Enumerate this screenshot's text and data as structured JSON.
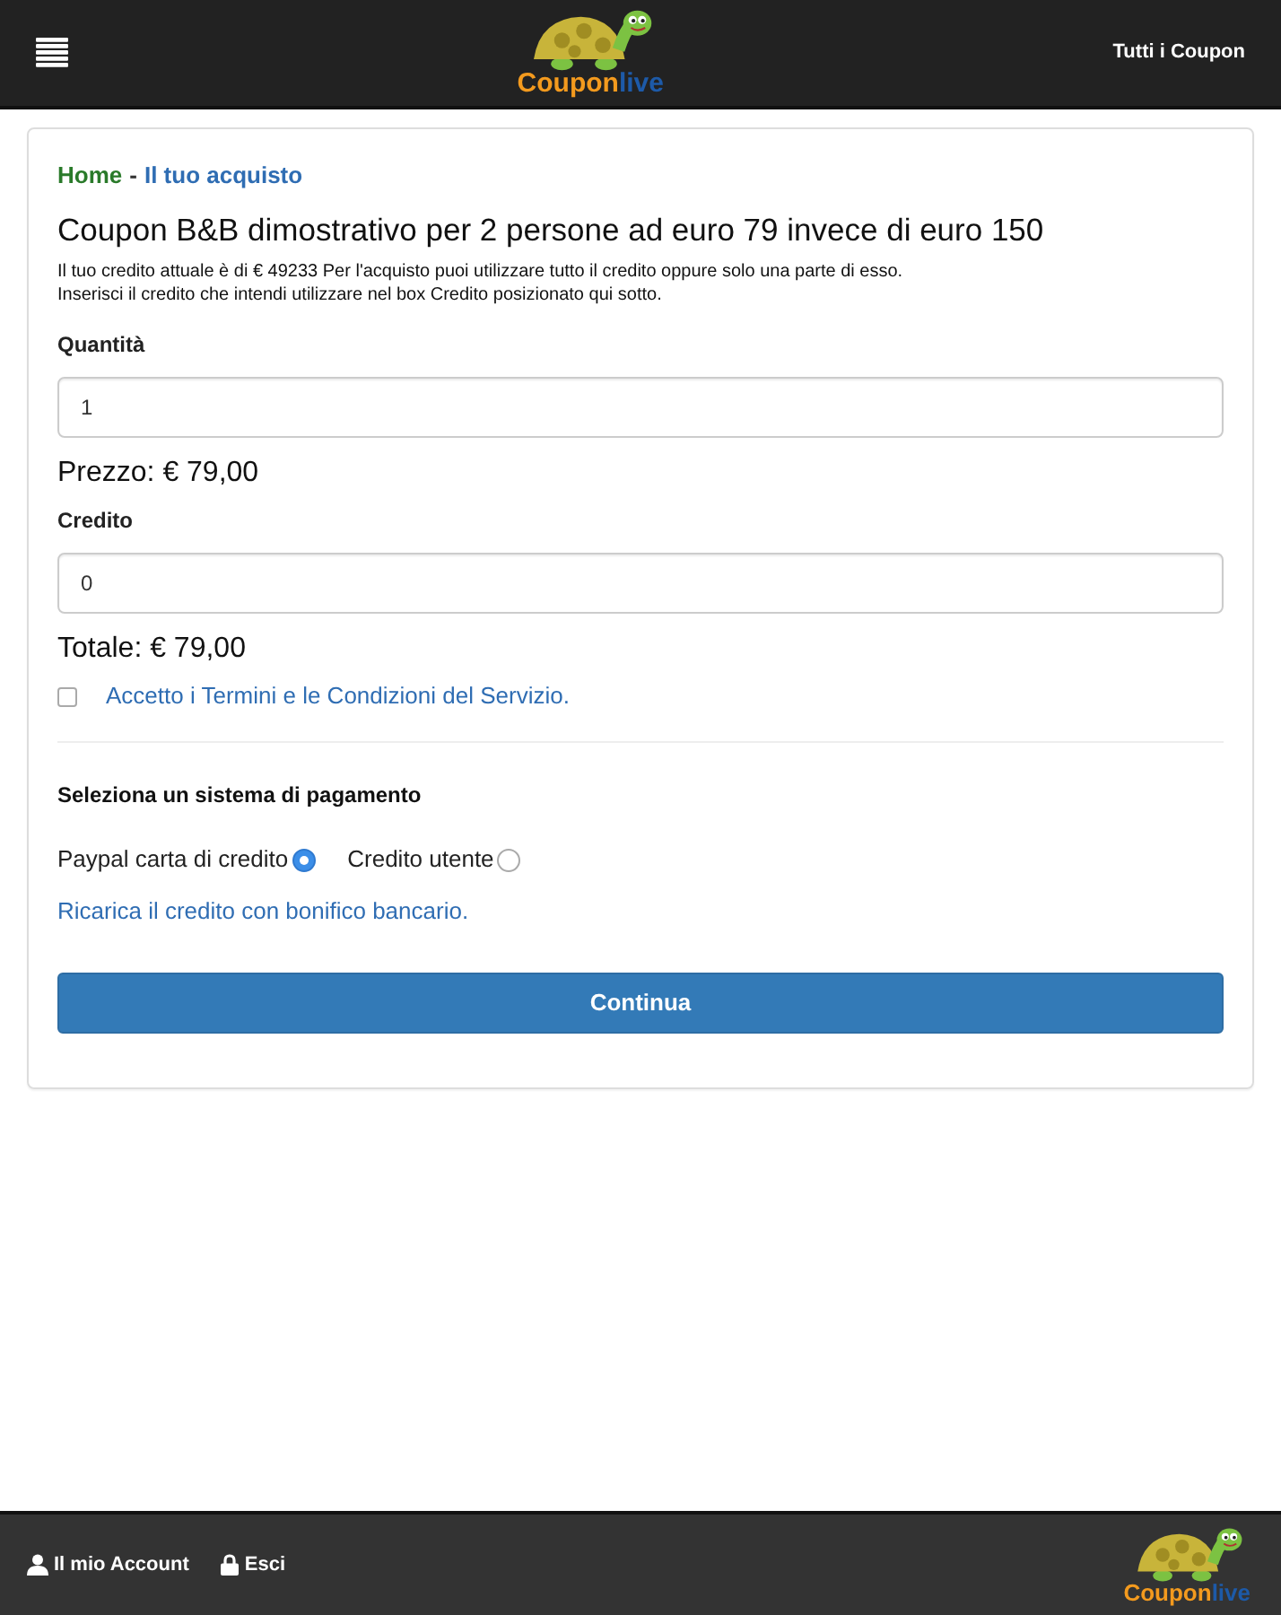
{
  "header": {
    "logo": {
      "word_1": "Coupon",
      "word_2": "live"
    },
    "link": "Tutti i Coupon"
  },
  "breadcrumb": {
    "items": [
      {
        "label": "Home",
        "color": "#2a7a2a"
      },
      {
        "label": "Il tuo acquisto",
        "color": "#2f6db3"
      }
    ],
    "separator": "-"
  },
  "title": "Coupon B&B dimostrativo per 2 persone ad euro 79 invece di euro 150",
  "credit_note": [
    "Il tuo credito attuale è di € 49233 Per l'acquisto puoi utilizzare tutto il credito oppure solo una parte di esso.",
    "Inserisci il credito che intendi utilizzare nel box Credito posizionato qui sotto."
  ],
  "quantity": {
    "label": "Quantità",
    "value": "1"
  },
  "price": "Prezzo: € 79,00",
  "credit": {
    "label": "Credito",
    "value": "0"
  },
  "total": "Totale: € 79,00",
  "terms": {
    "label": "Accetto i Termini e le Condizioni del Servizio.",
    "checked": false
  },
  "payment": {
    "title": "Seleziona un sistema di pagamento",
    "options": [
      {
        "label": "Paypal carta di credito",
        "selected": true
      },
      {
        "label": "Credito utente",
        "selected": false
      }
    ],
    "link": "Ricarica il credito con bonifico bancario."
  },
  "submit": "Continua",
  "footer": {
    "links": [
      {
        "kind": "user",
        "label": "Il mio Account"
      },
      {
        "kind": "lock",
        "label": "Esci"
      }
    ],
    "logo": {
      "word_1": "Coupon",
      "word_2": "live"
    }
  }
}
